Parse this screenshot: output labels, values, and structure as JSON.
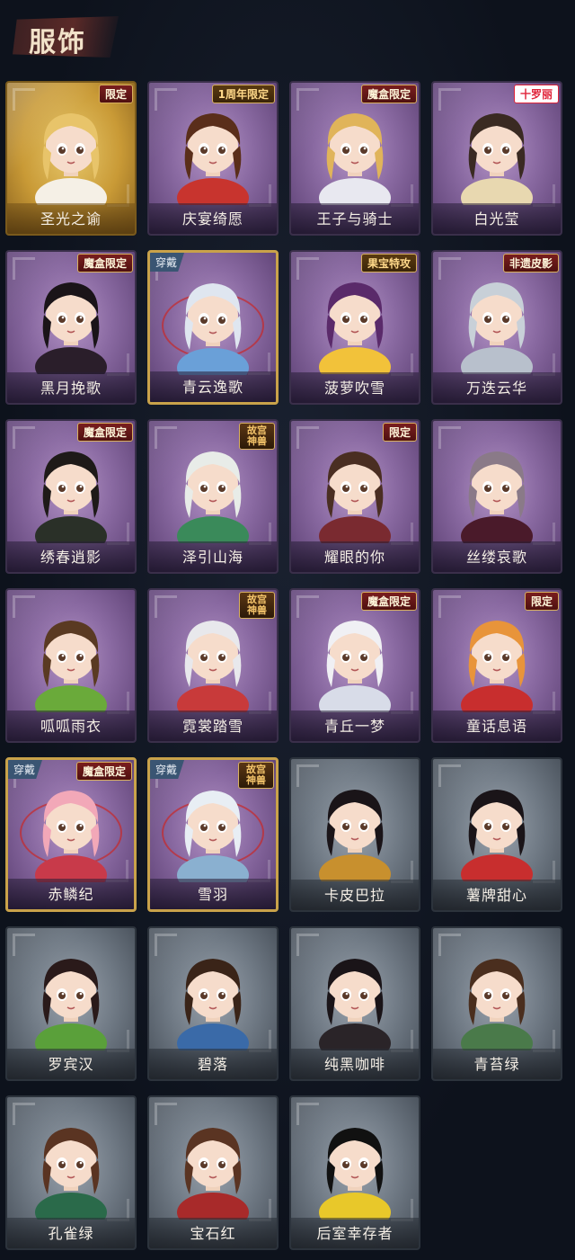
{
  "header": {
    "title": "服饰"
  },
  "cards": [
    {
      "name": "圣光之谕",
      "tag": "限定",
      "tag_style": "limited",
      "rarity": "gold",
      "equipped": false,
      "hair": "#e8c46a",
      "outfit": "#f5f0e6"
    },
    {
      "name": "庆宴绮愿",
      "tag": "1周年限定",
      "tag_style": "event",
      "rarity": "purple",
      "equipped": false,
      "hair": "#5a2e1a",
      "outfit": "#c8342e"
    },
    {
      "name": "王子与骑士",
      "tag": "魔盒限定",
      "tag_style": "limited",
      "rarity": "purple",
      "equipped": false,
      "hair": "#e0b45a",
      "outfit": "#e8e8f0"
    },
    {
      "name": "白光莹",
      "tag": "十罗丽",
      "tag_style": "brand",
      "rarity": "purple",
      "equipped": false,
      "hair": "#3a2a22",
      "outfit": "#e8d8b0"
    },
    {
      "name": "黑月挽歌",
      "tag": "魔盒限定",
      "tag_style": "limited",
      "rarity": "purple",
      "equipped": false,
      "hair": "#1a1418",
      "outfit": "#2a1e2a"
    },
    {
      "name": "青云逸歌",
      "tag": "",
      "tag_style": "",
      "rarity": "purple",
      "equipped": true,
      "wear_label": "穿戴",
      "hair": "#dfe6f0",
      "outfit": "#6aa0d8"
    },
    {
      "name": "菠萝吹雪",
      "tag": "果宝特攻",
      "tag_style": "event",
      "rarity": "purple",
      "equipped": false,
      "hair": "#5a2a6a",
      "outfit": "#f2c23a"
    },
    {
      "name": "万迭云华",
      "tag": "非遗皮影",
      "tag_style": "limited",
      "rarity": "purple",
      "equipped": false,
      "hair": "#c8d0d8",
      "outfit": "#b8c0cc"
    },
    {
      "name": "绣春逍影",
      "tag": "魔盒限定",
      "tag_style": "limited",
      "rarity": "purple",
      "equipped": false,
      "hair": "#1e1a18",
      "outfit": "#2a3028"
    },
    {
      "name": "泽引山海",
      "tag": "故宫神兽",
      "tag_style": "palace",
      "rarity": "purple",
      "equipped": false,
      "hair": "#e8ece8",
      "outfit": "#3a8a5a"
    },
    {
      "name": "耀眼的你",
      "tag": "限定",
      "tag_style": "limited",
      "rarity": "purple",
      "equipped": false,
      "hair": "#4a2e22",
      "outfit": "#7a2a30"
    },
    {
      "name": "丝缕哀歌",
      "tag": "",
      "tag_style": "",
      "rarity": "purple",
      "equipped": false,
      "hair": "#8a7a88",
      "outfit": "#4a1a2a"
    },
    {
      "name": "呱呱雨衣",
      "tag": "",
      "tag_style": "",
      "rarity": "purple",
      "equipped": false,
      "hair": "#5a3a22",
      "outfit": "#6aaa3a"
    },
    {
      "name": "霓裳踏雪",
      "tag": "故宫神兽",
      "tag_style": "palace",
      "rarity": "purple",
      "equipped": false,
      "hair": "#e8e8ec",
      "outfit": "#c83a3a"
    },
    {
      "name": "青丘一梦",
      "tag": "魔盒限定",
      "tag_style": "limited",
      "rarity": "purple",
      "equipped": false,
      "hair": "#f0f0f4",
      "outfit": "#d8dce8"
    },
    {
      "name": "童话息语",
      "tag": "限定",
      "tag_style": "limited",
      "rarity": "purple",
      "equipped": false,
      "hair": "#e8943a",
      "outfit": "#c82e2e"
    },
    {
      "name": "赤鳞纪",
      "tag": "魔盒限定",
      "tag_style": "limited",
      "rarity": "purple",
      "equipped": true,
      "wear_label": "穿戴",
      "hair": "#f2a8b8",
      "outfit": "#c83a4a"
    },
    {
      "name": "雪羽",
      "tag": "故宫神兽",
      "tag_style": "palace",
      "rarity": "purple",
      "equipped": true,
      "wear_label": "穿戴",
      "hair": "#e8eef4",
      "outfit": "#8ab0d0"
    },
    {
      "name": "卡皮巴拉",
      "tag": "",
      "tag_style": "",
      "rarity": "grey",
      "equipped": false,
      "hair": "#1a1418",
      "outfit": "#c8902e"
    },
    {
      "name": "薯牌甜心",
      "tag": "",
      "tag_style": "",
      "rarity": "grey",
      "equipped": false,
      "hair": "#1a1418",
      "outfit": "#c82e2e"
    },
    {
      "name": "罗宾汉",
      "tag": "",
      "tag_style": "",
      "rarity": "grey",
      "equipped": false,
      "hair": "#2a1a1a",
      "outfit": "#5aa03a"
    },
    {
      "name": "碧落",
      "tag": "",
      "tag_style": "",
      "rarity": "grey",
      "equipped": false,
      "hair": "#3a2418",
      "outfit": "#3a6aa8"
    },
    {
      "name": "纯黑咖啡",
      "tag": "",
      "tag_style": "",
      "rarity": "grey",
      "equipped": false,
      "hair": "#1a1418",
      "outfit": "#2a2428"
    },
    {
      "name": "青苔绿",
      "tag": "",
      "tag_style": "",
      "rarity": "grey",
      "equipped": false,
      "hair": "#4a2e1e",
      "outfit": "#4a7a4a"
    },
    {
      "name": "孔雀绿",
      "tag": "",
      "tag_style": "",
      "rarity": "grey",
      "equipped": false,
      "hair": "#5a3422",
      "outfit": "#2a6a4a"
    },
    {
      "name": "宝石红",
      "tag": "",
      "tag_style": "",
      "rarity": "grey",
      "equipped": false,
      "hair": "#5a3422",
      "outfit": "#a82a2a"
    },
    {
      "name": "后室幸存者",
      "tag": "",
      "tag_style": "",
      "rarity": "grey",
      "equipped": false,
      "hair": "#111111",
      "outfit": "#e8c82a"
    }
  ]
}
